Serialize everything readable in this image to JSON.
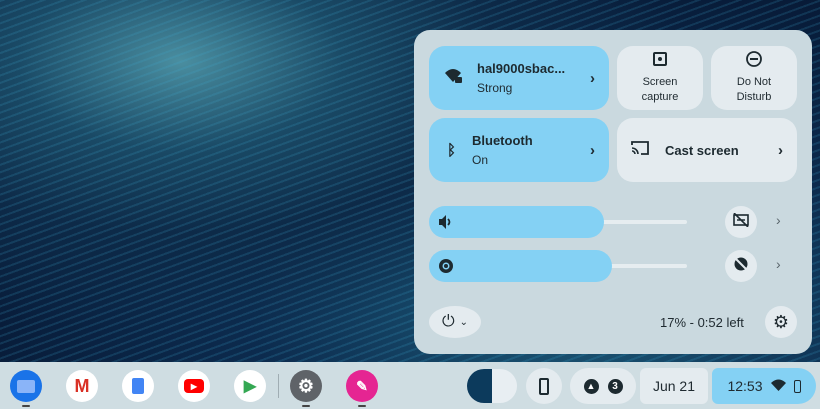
{
  "quick_settings": {
    "network": {
      "name": "hal9000sbac...",
      "status": "Strong"
    },
    "bluetooth": {
      "name": "Bluetooth",
      "status": "On"
    },
    "screen_capture": {
      "line1": "Screen",
      "line2": "capture"
    },
    "do_not_disturb": {
      "line1": "Do Not",
      "line2": "Disturb"
    },
    "cast": {
      "label": "Cast screen"
    },
    "volume": {
      "level": 0.68
    },
    "brightness": {
      "level": 0.71
    },
    "battery_text": "17% - 0:52 left"
  },
  "shelf": {
    "apps": [
      "Files",
      "Gmail",
      "Docs",
      "YouTube",
      "Play Store",
      "Settings",
      "Canvas"
    ],
    "notification_count": "3",
    "date": "Jun 21",
    "time": "12:53"
  },
  "colors": {
    "accent": "#84d1f4",
    "panel": "#cad9df"
  }
}
